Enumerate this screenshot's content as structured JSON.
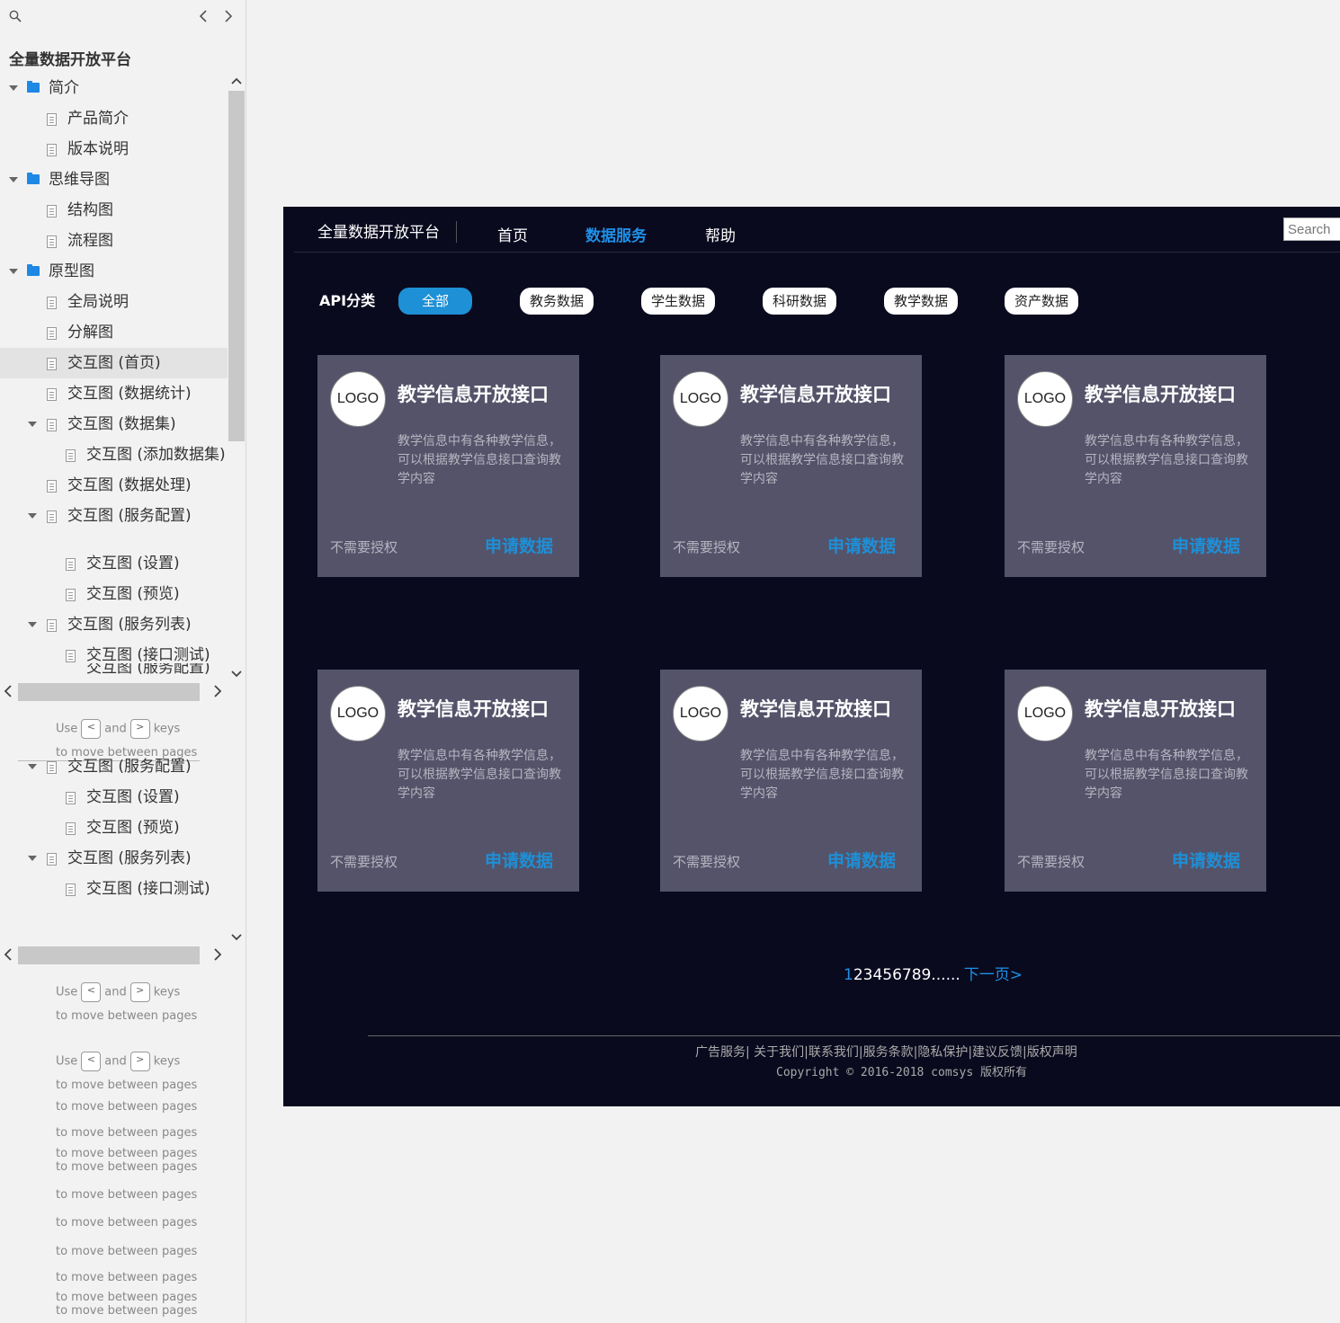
{
  "sidebar": {
    "title": "全量数据开放平台",
    "icons": {
      "search": "search-icon",
      "prev": "chevron-left-icon",
      "next": "chevron-right-icon"
    },
    "tree": [
      {
        "label": "简介",
        "type": "folder",
        "level": 0,
        "expanded": true
      },
      {
        "label": "产品简介",
        "type": "page",
        "level": 1
      },
      {
        "label": "版本说明",
        "type": "page",
        "level": 1
      },
      {
        "label": "思维导图",
        "type": "folder",
        "level": 0,
        "expanded": true
      },
      {
        "label": "结构图",
        "type": "page",
        "level": 1
      },
      {
        "label": "流程图",
        "type": "page",
        "level": 1
      },
      {
        "label": "原型图",
        "type": "folder",
        "level": 0,
        "expanded": true
      },
      {
        "label": "全局说明",
        "type": "page",
        "level": 1
      },
      {
        "label": "分解图",
        "type": "page",
        "level": 1
      },
      {
        "label": "交互图 (首页)",
        "type": "page",
        "level": 1,
        "selected": true
      },
      {
        "label": "交互图 (数据统计)",
        "type": "page",
        "level": 1
      },
      {
        "label": "交互图 (数据集)",
        "type": "page",
        "level": 1,
        "expandable": true
      },
      {
        "label": "交互图 (添加数据集)",
        "type": "page",
        "level": 2
      },
      {
        "label": "交互图 (数据处理)",
        "type": "page",
        "level": 1
      },
      {
        "label": "交互图 (服务配置)",
        "type": "page",
        "level": 1,
        "expandable": true
      }
    ],
    "tree_b": [
      {
        "label": "交互图 (设置)",
        "type": "page",
        "level": 2
      },
      {
        "label": "交互图 (预览)",
        "type": "page",
        "level": 2
      },
      {
        "label": "交互图 (服务列表)",
        "type": "page",
        "level": 1,
        "expandable": true
      },
      {
        "label": "交互图 (接口测试)",
        "type": "page",
        "level": 2
      }
    ],
    "tree_c": [
      {
        "label": "交互图 (服务配置)",
        "type": "page",
        "level": 1,
        "expandable": true
      },
      {
        "label": "交互图 (设置)",
        "type": "page",
        "level": 2
      },
      {
        "label": "交互图 (预览)",
        "type": "page",
        "level": 2
      },
      {
        "label": "交互图 (服务列表)",
        "type": "page",
        "level": 1,
        "expandable": true
      },
      {
        "label": "交互图 (接口测试)",
        "type": "page",
        "level": 2
      }
    ],
    "hint": {
      "use": "Use",
      "and": "and",
      "keys": "keys",
      "prev_key": "<",
      "next_key": ">",
      "move": "to move between pages"
    }
  },
  "nav": {
    "brand": "全量数据开放平台",
    "items": [
      "首页",
      "数据服务",
      "帮助"
    ],
    "active": "数据服务",
    "search_placeholder": "Search"
  },
  "api": {
    "label": "API分类",
    "categories": [
      "全部",
      "教务数据",
      "学生数据",
      "科研数据",
      "教学数据",
      "资产数据"
    ],
    "active": "全部"
  },
  "cards": [
    {
      "logo": "LOGO",
      "title": "教学信息开放接口",
      "desc": "教学信息中有各种教学信息，可以根据教学信息接口查询教学内容",
      "auth": "不需要授权",
      "apply": "申请数据"
    },
    {
      "logo": "LOGO",
      "title": "教学信息开放接口",
      "desc": "教学信息中有各种教学信息，可以根据教学信息接口查询教学内容",
      "auth": "不需要授权",
      "apply": "申请数据"
    },
    {
      "logo": "LOGO",
      "title": "教学信息开放接口",
      "desc": "教学信息中有各种教学信息，可以根据教学信息接口查询教学内容",
      "auth": "不需要授权",
      "apply": "申请数据"
    },
    {
      "logo": "LOGO",
      "title": "教学信息开放接口",
      "desc": "教学信息中有各种教学信息，可以根据教学信息接口查询教学内容",
      "auth": "不需要授权",
      "apply": "申请数据"
    },
    {
      "logo": "LOGO",
      "title": "教学信息开放接口",
      "desc": "教学信息中有各种教学信息，可以根据教学信息接口查询教学内容",
      "auth": "不需要授权",
      "apply": "申请数据"
    },
    {
      "logo": "LOGO",
      "title": "教学信息开放接口",
      "desc": "教学信息中有各种教学信息，可以根据教学信息接口查询教学内容",
      "auth": "不需要授权",
      "apply": "申请数据"
    }
  ],
  "pager": {
    "current": "1",
    "pages": "23456789",
    "ellipsis": "......",
    "next": "下一页>"
  },
  "footer": {
    "links": "广告服务| 关于我们|联系我们|服务条款|隐私保护|建议反馈|版权声明",
    "copyright": "Copyright © 2016-2018 comsys 版权所有"
  },
  "colors": {
    "frame_bg": "#0a0a1f",
    "card_bg": "#54536a",
    "accent": "#1e90e6"
  }
}
